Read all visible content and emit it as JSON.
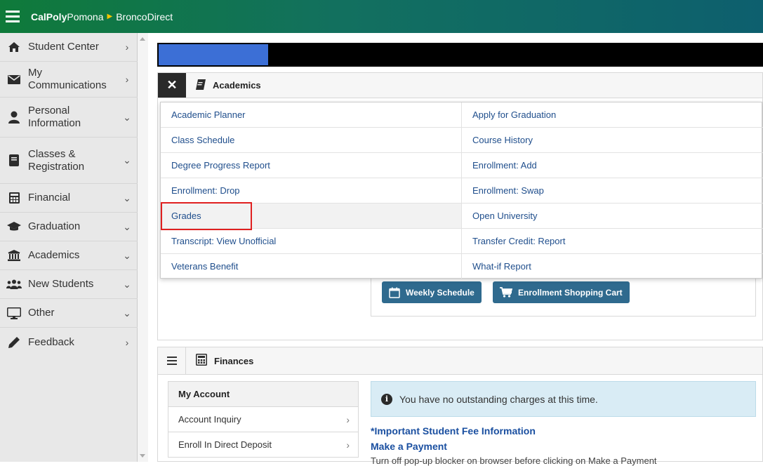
{
  "header": {
    "brand_bold": "CalPoly",
    "brand_light": "Pomona",
    "brand_app": "BroncoDirect",
    "colors": {
      "bar_start": "#0f7a3a",
      "bar_end": "#0d5f6e",
      "accent": "#f5c400"
    }
  },
  "sidebar": {
    "items": [
      {
        "label": "Student Center",
        "icon": "home-icon",
        "chevron": "›"
      },
      {
        "label": "My Communications",
        "icon": "envelope-icon",
        "chevron": "›"
      },
      {
        "label": "Personal Information",
        "icon": "user-icon",
        "chevron": "⌄"
      },
      {
        "label": "Classes & Registration",
        "icon": "book-icon",
        "chevron": "⌄"
      },
      {
        "label": "Financial",
        "icon": "calculator-icon",
        "chevron": "⌄"
      },
      {
        "label": "Graduation",
        "icon": "graduation-cap-icon",
        "chevron": "⌄"
      },
      {
        "label": "Academics",
        "icon": "university-icon",
        "chevron": "⌄"
      },
      {
        "label": "New Students",
        "icon": "users-icon",
        "chevron": "⌄"
      },
      {
        "label": "Other",
        "icon": "desktop-icon",
        "chevron": "⌄"
      },
      {
        "label": "Feedback",
        "icon": "pencil-icon",
        "chevron": "›"
      }
    ]
  },
  "academics": {
    "title": "Academics",
    "close_icon": "close-icon",
    "menu": [
      {
        "left": "Academic Planner",
        "right": "Apply for Graduation"
      },
      {
        "left": "Class Schedule",
        "right": "Course History"
      },
      {
        "left": "Degree Progress Report",
        "right": "Enrollment: Add"
      },
      {
        "left": "Enrollment: Drop",
        "right": "Enrollment: Swap"
      },
      {
        "left": "Grades",
        "right": "Open University"
      },
      {
        "left": "Transcript: View Unofficial",
        "right": "Transfer Credit: Report"
      },
      {
        "left": "Veterans Benefit",
        "right": "What-if Report"
      }
    ],
    "highlighted": "Grades",
    "buttons": {
      "weekly": "Weekly Schedule",
      "cart": "Enrollment Shopping Cart"
    }
  },
  "finances": {
    "title": "Finances",
    "account_header": "My Account",
    "account_items": [
      "Account Inquiry",
      "Enroll In Direct Deposit"
    ],
    "info_message": "You have no outstanding charges at this time.",
    "fee_link": "*Important Student Fee Information",
    "payment_link": "Make a Payment",
    "payment_note": "Turn off pop-up blocker on browser before clicking on Make a Payment"
  }
}
